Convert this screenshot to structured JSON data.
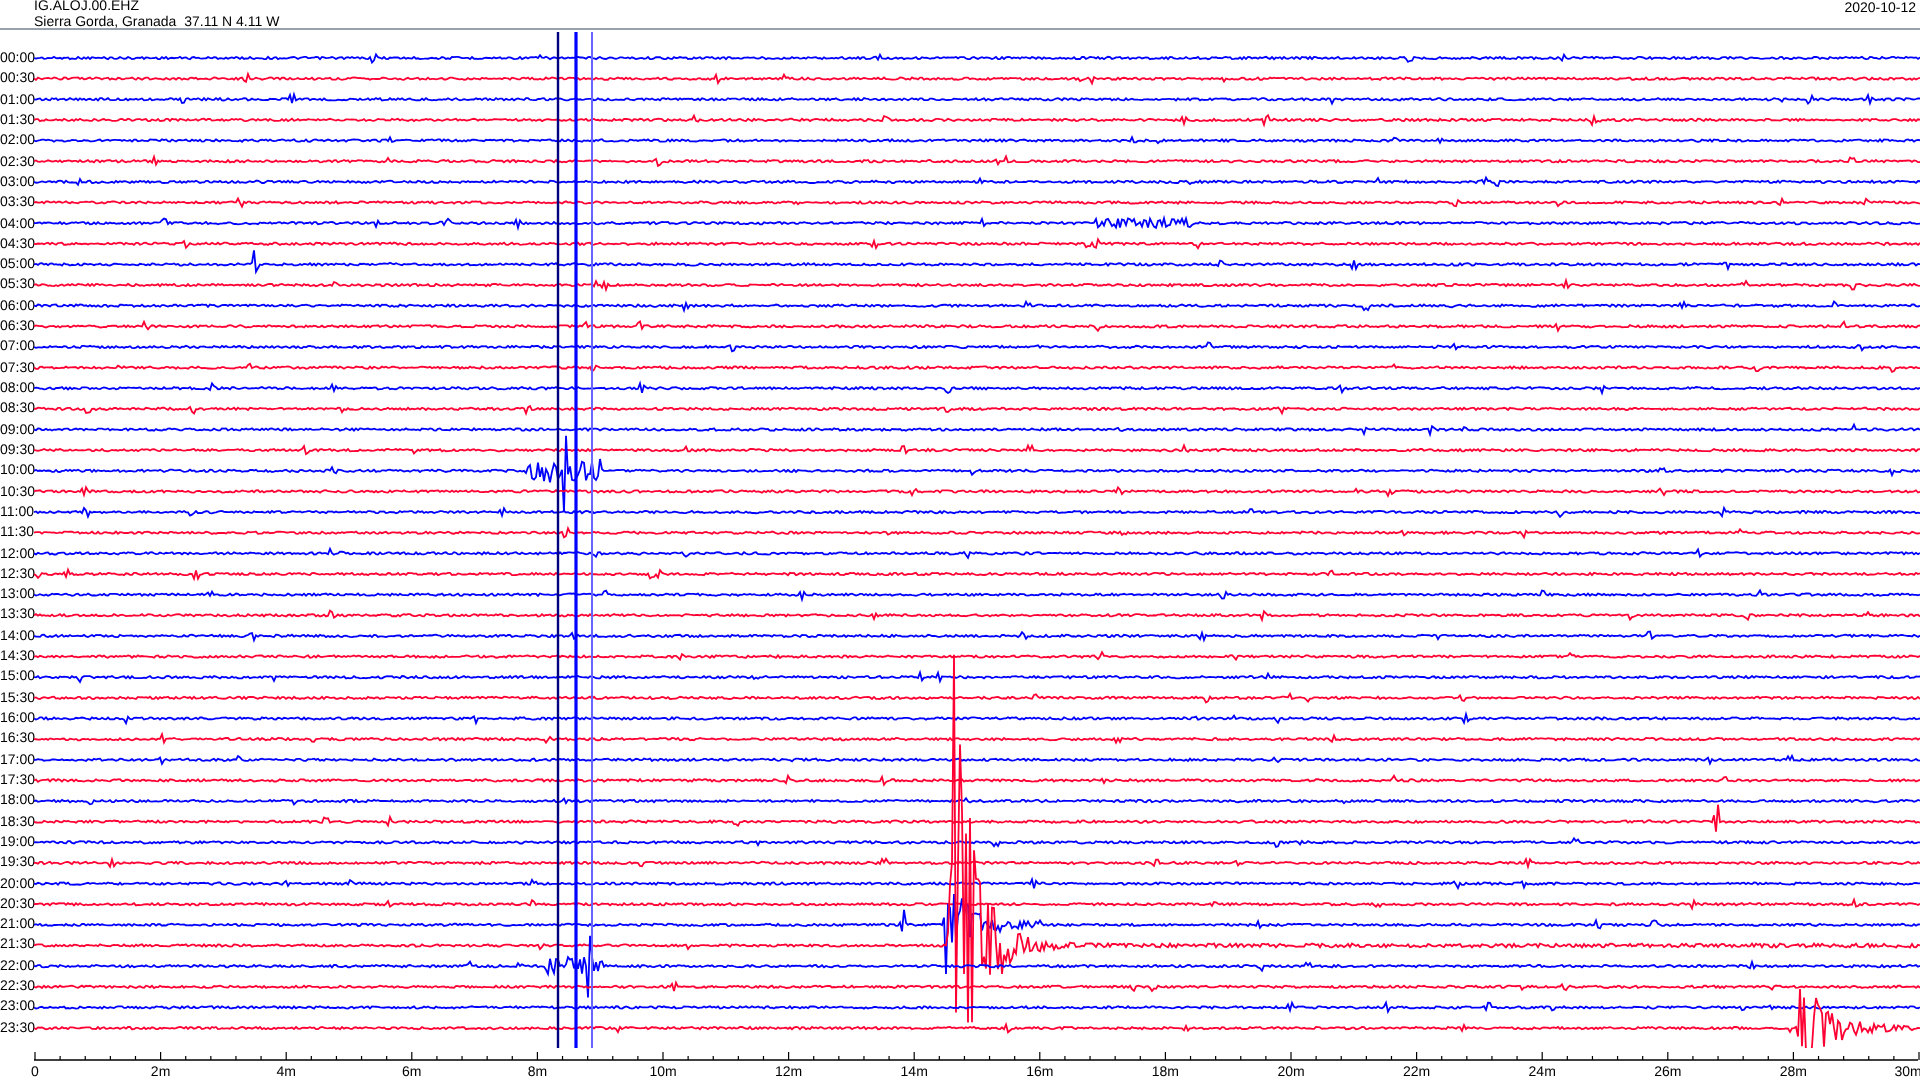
{
  "header": {
    "station": "IG.ALOJ.00.EHZ",
    "location": "Sierra Gorda, Granada  37.11 N 4.11 W",
    "date": "2020-10-12"
  },
  "rows": [
    {
      "time": "00:00",
      "color": "#0000ff"
    },
    {
      "time": "00:30",
      "color": "#ff0033"
    },
    {
      "time": "01:00",
      "color": "#0000ff"
    },
    {
      "time": "01:30",
      "color": "#ff0033"
    },
    {
      "time": "02:00",
      "color": "#0000ff"
    },
    {
      "time": "02:30",
      "color": "#ff0033"
    },
    {
      "time": "03:00",
      "color": "#0000ff"
    },
    {
      "time": "03:30",
      "color": "#ff0033"
    },
    {
      "time": "04:00",
      "color": "#0000ff"
    },
    {
      "time": "04:30",
      "color": "#ff0033"
    },
    {
      "time": "05:00",
      "color": "#0000ff"
    },
    {
      "time": "05:30",
      "color": "#ff0033"
    },
    {
      "time": "06:00",
      "color": "#0000ff"
    },
    {
      "time": "06:30",
      "color": "#ff0033"
    },
    {
      "time": "07:00",
      "color": "#0000ff"
    },
    {
      "time": "07:30",
      "color": "#ff0033"
    },
    {
      "time": "08:00",
      "color": "#0000ff"
    },
    {
      "time": "08:30",
      "color": "#ff0033"
    },
    {
      "time": "09:00",
      "color": "#0000ff"
    },
    {
      "time": "09:30",
      "color": "#ff0033"
    },
    {
      "time": "10:00",
      "color": "#0000ff"
    },
    {
      "time": "10:30",
      "color": "#ff0033"
    },
    {
      "time": "11:00",
      "color": "#0000ff"
    },
    {
      "time": "11:30",
      "color": "#ff0033"
    },
    {
      "time": "12:00",
      "color": "#0000ff"
    },
    {
      "time": "12:30",
      "color": "#ff0033"
    },
    {
      "time": "13:00",
      "color": "#0000ff"
    },
    {
      "time": "13:30",
      "color": "#ff0033"
    },
    {
      "time": "14:00",
      "color": "#0000ff"
    },
    {
      "time": "14:30",
      "color": "#ff0033"
    },
    {
      "time": "15:00",
      "color": "#0000ff"
    },
    {
      "time": "15:30",
      "color": "#ff0033"
    },
    {
      "time": "16:00",
      "color": "#0000ff"
    },
    {
      "time": "16:30",
      "color": "#ff0033"
    },
    {
      "time": "17:00",
      "color": "#0000ff"
    },
    {
      "time": "17:30",
      "color": "#ff0033"
    },
    {
      "time": "18:00",
      "color": "#0000ff"
    },
    {
      "time": "18:30",
      "color": "#ff0033"
    },
    {
      "time": "19:00",
      "color": "#0000ff"
    },
    {
      "time": "19:30",
      "color": "#ff0033"
    },
    {
      "time": "20:00",
      "color": "#0000ff"
    },
    {
      "time": "20:30",
      "color": "#ff0033"
    },
    {
      "time": "21:00",
      "color": "#0000ff"
    },
    {
      "time": "21:30",
      "color": "#ff0033"
    },
    {
      "time": "22:00",
      "color": "#0000ff"
    },
    {
      "time": "22:30",
      "color": "#ff0033"
    },
    {
      "time": "23:00",
      "color": "#0000ff"
    },
    {
      "time": "23:30",
      "color": "#ff0033"
    }
  ],
  "x_axis": {
    "ticks": [
      "0",
      "2m",
      "4m",
      "6m",
      "8m",
      "10m",
      "12m",
      "14m",
      "16m",
      "18m",
      "20m",
      "22m",
      "24m",
      "26m",
      "28m",
      "30m"
    ]
  }
}
